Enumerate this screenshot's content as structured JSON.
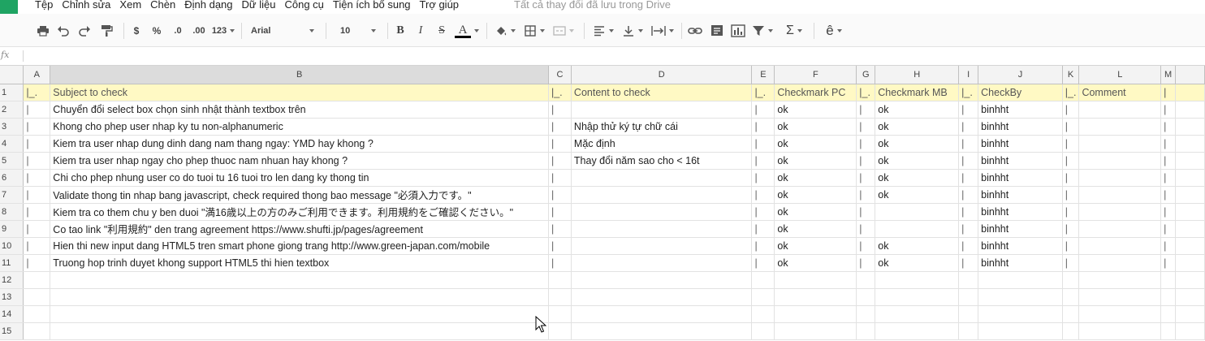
{
  "menu": {
    "items": [
      "Tệp",
      "Chỉnh sửa",
      "Xem",
      "Chèn",
      "Định dạng",
      "Dữ liệu",
      "Công cụ",
      "Tiện ích bổ sung",
      "Trợ giúp"
    ],
    "save_status": "Tất cả thay đổi đã lưu trong Drive"
  },
  "toolbar": {
    "currency": "$",
    "percent": "%",
    "dec_decrease": ".0",
    "dec_increase": ".00",
    "more_formats": "123",
    "font": "Arial",
    "font_size": "10",
    "bold": "B",
    "italic": "I",
    "strike": "S",
    "text_color": "A",
    "sum": "Σ",
    "input_tools": "ê",
    "text_color_hex": "#000000"
  },
  "formula_bar": {
    "fx": "fx",
    "value": ""
  },
  "columns": [
    "A",
    "B",
    "C",
    "D",
    "E",
    "F",
    "G",
    "H",
    "I",
    "J",
    "K",
    "L",
    "M"
  ],
  "selected_column": "B",
  "row_numbers": [
    "1",
    "2",
    "3",
    "4",
    "5",
    "6",
    "7",
    "8",
    "9",
    "10",
    "11",
    "12",
    "13",
    "14",
    "15"
  ],
  "header_row": {
    "A": "|_.",
    "B": "Subject to check",
    "C": "|_.",
    "D": "Content to check",
    "E": "|_.",
    "F": "Checkmark PC",
    "G": "|_.",
    "H": "Checkmark MB",
    "I": "|_.",
    "J": "CheckBy",
    "K": "|_.",
    "L": "Comment",
    "M": "|"
  },
  "rows": [
    {
      "A": "|",
      "B": "Chuyển đổi select box chọn sinh nhật thành textbox trên",
      "C": "|",
      "D": "",
      "E": "|",
      "F": "ok",
      "G": "|",
      "H": "ok",
      "I": "|",
      "J": "binhht",
      "K": "|",
      "L": "",
      "M": "|"
    },
    {
      "A": "|",
      "B": "Khong cho phep user nhap ky tu non-alphanumeric",
      "C": "|",
      "D": "Nhập thử ký tự chữ cái",
      "E": "|",
      "F": "ok",
      "G": "|",
      "H": "ok",
      "I": "|",
      "J": "binhht",
      "K": "|",
      "L": "",
      "M": "|"
    },
    {
      "A": "|",
      "B": "Kiem tra user nhap dung dinh dang nam thang ngay: YMD hay khong ?",
      "C": "|",
      "D": "Mặc định",
      "E": "|",
      "F": "ok",
      "G": "|",
      "H": "ok",
      "I": "|",
      "J": "binhht",
      "K": "|",
      "L": "",
      "M": "|"
    },
    {
      "A": "|",
      "B": "Kiem tra user nhap ngay cho phep thuoc nam nhuan hay khong ?",
      "C": "|",
      "D": "Thay đổi năm sao cho < 16t",
      "E": "|",
      "F": "ok",
      "G": "|",
      "H": "ok",
      "I": "|",
      "J": "binhht",
      "K": "|",
      "L": "",
      "M": "|"
    },
    {
      "A": "|",
      "B": "Chi cho phep nhung user co do tuoi tu 16 tuoi tro len dang ky thong tin",
      "C": "|",
      "D": "",
      "E": "|",
      "F": "ok",
      "G": "|",
      "H": "ok",
      "I": "|",
      "J": "binhht",
      "K": "|",
      "L": "",
      "M": "|"
    },
    {
      "A": "|",
      "B": "Validate thong tin nhap bang javascript, check required thong bao message \"必須入力です。\"",
      "C": "|",
      "D": "",
      "E": "|",
      "F": "ok",
      "G": "|",
      "H": "ok",
      "I": "|",
      "J": "binhht",
      "K": "|",
      "L": "",
      "M": "|"
    },
    {
      "A": "|",
      "B": "Kiem tra co them chu y ben duoi \"満16歳以上の方のみご利用できます。利用規約をご確認ください。\"",
      "C": "|",
      "D": "",
      "E": "|",
      "F": "ok",
      "G": "|",
      "H": "",
      "I": "|",
      "J": "binhht",
      "K": "|",
      "L": "",
      "M": "|"
    },
    {
      "A": "|",
      "B": "Co tao link \"利用規約\" den trang agreement https://www.shufti.jp/pages/agreement",
      "C": "|",
      "D": "",
      "E": "|",
      "F": "ok",
      "G": "|",
      "H": "",
      "I": "|",
      "J": "binhht",
      "K": "|",
      "L": "",
      "M": "|"
    },
    {
      "A": "|",
      "B": "Hien thi new input dang HTML5 tren smart phone giong trang http://www.green-japan.com/mobile",
      "C": "|",
      "D": "",
      "E": "|",
      "F": "ok",
      "G": "|",
      "H": "ok",
      "I": "|",
      "J": "binhht",
      "K": "|",
      "L": "",
      "M": "|"
    },
    {
      "A": "|",
      "B": "Truong hop trinh duyet khong support HTML5 thi hien textbox",
      "C": "|",
      "D": "",
      "E": "|",
      "F": "ok",
      "G": "|",
      "H": "ok",
      "I": "|",
      "J": "binhht",
      "K": "|",
      "L": "",
      "M": "|"
    }
  ],
  "colors": {
    "brand": "#1fa463",
    "header_fill": "#fff9c4",
    "selected_col": "#dcdcdc"
  }
}
